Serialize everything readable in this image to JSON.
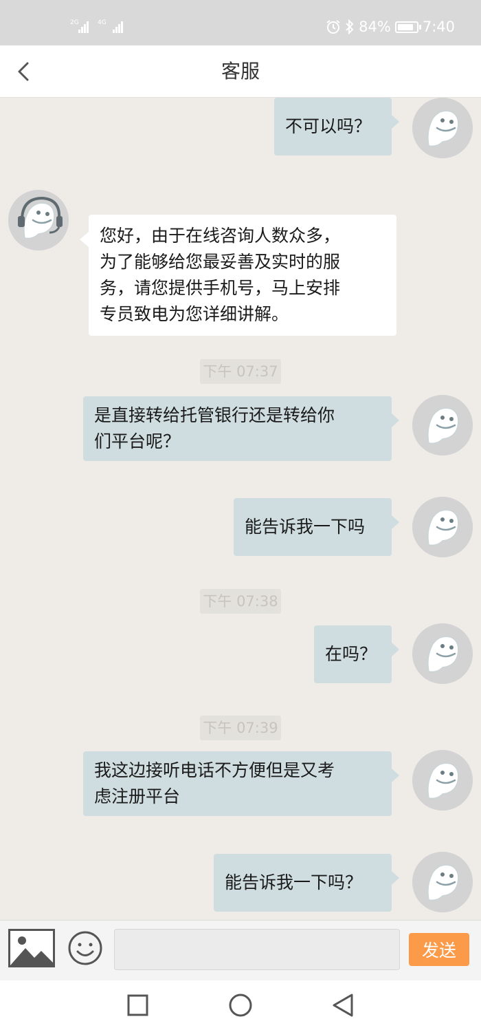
{
  "status_bar": {
    "signal_1_label": "2G",
    "signal_2_label": "4G",
    "battery": "84%",
    "time": "7:40",
    "battery_level": 0.84
  },
  "header": {
    "title": "客服"
  },
  "messages": [
    {
      "side": "out",
      "lines": [
        "不可以吗？"
      ]
    },
    {
      "side": "in",
      "lines": [
        "您好，由于在线咨询人数众多，",
        "为了能够给您最妥善及实时的服",
        "务，请您提供手机号，马上安排",
        "专员致电为您详细讲解。"
      ]
    },
    {
      "type": "time",
      "text": "下午 07:37"
    },
    {
      "side": "out",
      "lines": [
        "是直接转给托管银行还是转给你",
        "们平台呢？"
      ]
    },
    {
      "side": "out",
      "lines": [
        "能告诉我一下吗"
      ]
    },
    {
      "type": "time",
      "text": "下午 07:38"
    },
    {
      "side": "out",
      "lines": [
        "在吗？"
      ]
    },
    {
      "type": "time",
      "text": "下午 07:39"
    },
    {
      "side": "out",
      "lines": [
        "我这边接听电话不方便但是又考",
        "虑注册平台"
      ]
    },
    {
      "side": "out",
      "lines": [
        "能告诉我一下吗？"
      ]
    }
  ],
  "input_bar": {
    "text_value": "",
    "send_label": "发送"
  },
  "colors": {
    "chat_background": "#efece7",
    "outgoing_bubble": "#cfdde0",
    "incoming_bubble": "#ffffff",
    "send_button": "#fb9b4a",
    "status_bar": "#d9d9d9"
  },
  "icons": {
    "back": "chevron-left-icon",
    "image": "image-icon",
    "emoji": "smiley-icon",
    "nav_recents": "square-icon",
    "nav_home": "circle-icon",
    "nav_back": "triangle-icon"
  }
}
